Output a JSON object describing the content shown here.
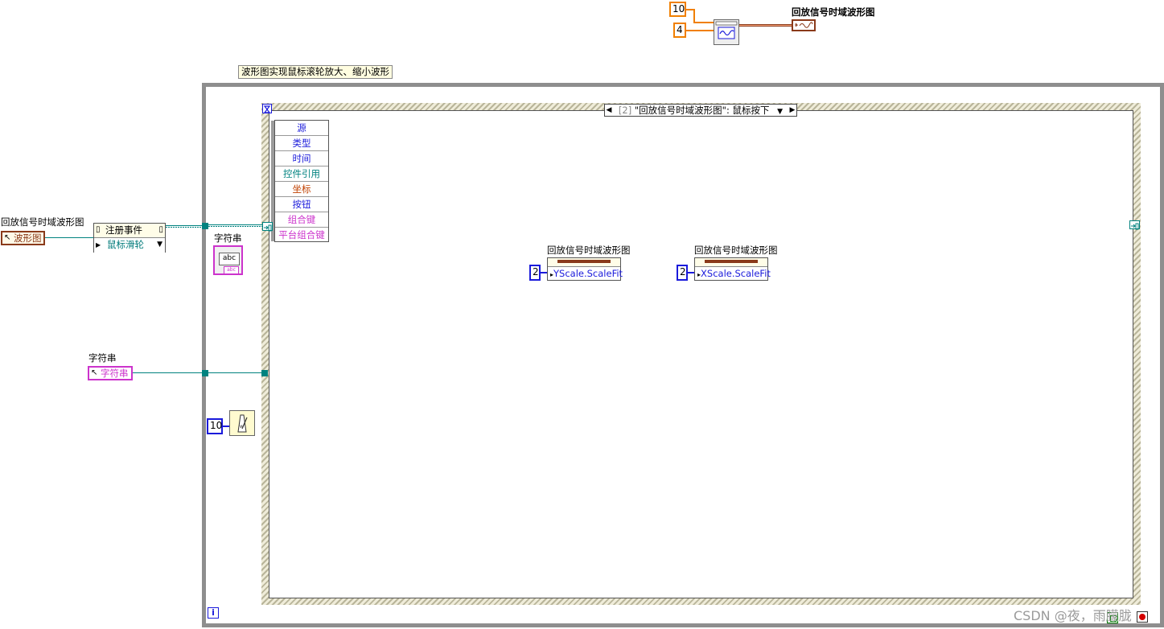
{
  "top_node": {
    "const_a": "10",
    "const_b": "4",
    "indicator_label": "回放信号时域波形图"
  },
  "comment": "波形图实现鼠标滚轮放大、缩小波形",
  "event_structure": {
    "case_index": "[2]",
    "case_label": "\"回放信号时域波形图\": 鼠标按下"
  },
  "event_data_node": {
    "items": [
      "源",
      "类型",
      "时间",
      "控件引用",
      "坐标",
      "按钮",
      "组合键",
      "平台组合键"
    ],
    "colors": [
      "#1a1adb",
      "#1a1adb",
      "#1a1adb",
      "#00827f",
      "#c04000",
      "#1a1adb",
      "#cc33cc",
      "#cc33cc"
    ]
  },
  "register_events": {
    "title": "注册事件",
    "event": "鼠标滑轮"
  },
  "left_controls": {
    "waveform_label": "回放信号时域波形图",
    "waveform_term": "波形图",
    "string_label": "字符串",
    "string_term": "字符串"
  },
  "string_indicator": {
    "label": "字符串",
    "icon_text": "abc"
  },
  "property_nodes": [
    {
      "label": "回放信号时域波形图",
      "const": "2",
      "prop": "YScale.ScaleFit"
    },
    {
      "label": "回放信号时域波形图",
      "const": "2",
      "prop": "XScale.ScaleFit"
    }
  ],
  "wait_const": "10",
  "watermark": "CSDN @夜，雨朦胧",
  "colors": {
    "orange": "#f07f00",
    "teal": "#00827f",
    "pink": "#cc33cc",
    "blue": "#1a1adb",
    "brown": "#8a3a1a"
  }
}
